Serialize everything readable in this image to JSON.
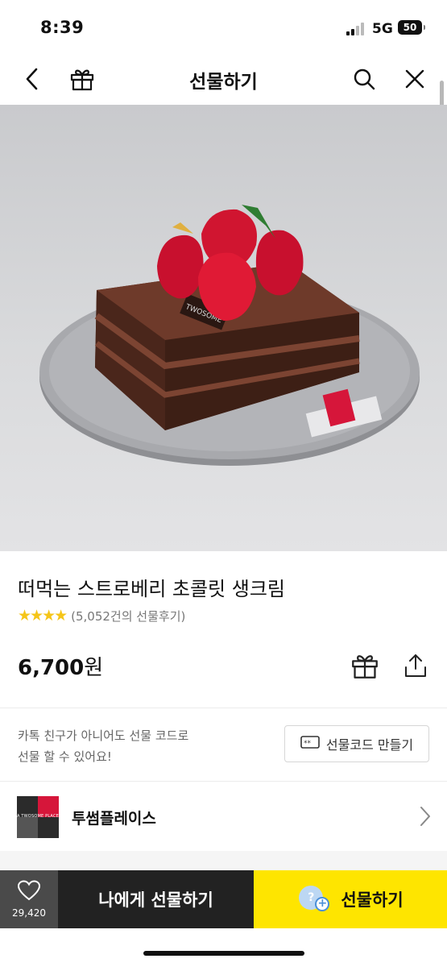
{
  "status_bar": {
    "time": "8:39",
    "network": "5G",
    "battery": "50"
  },
  "header": {
    "title": "선물하기"
  },
  "hero": {
    "topper_text": "TWOSOME"
  },
  "product": {
    "name": "떠먹는 스트로베리 초콜릿 생크림",
    "stars": "★★★★",
    "review_count": "(5,052건의 선물후기)",
    "price_number": "6,700",
    "price_unit": "원"
  },
  "gift_code": {
    "note_line1": "카톡 친구가 아니어도 선물 코드로",
    "note_line2": "선물 할 수 있어요!",
    "button_label": "선물코드 만들기"
  },
  "brand": {
    "name": "투썸플레이스",
    "logo_text": "A TWOSOME PLACE"
  },
  "bottom_bar": {
    "wish_count": "29,420",
    "self_gift_label": "나에게 선물하기",
    "gift_label": "선물하기",
    "gift_icon_char": "?"
  },
  "colors": {
    "accent_yellow": "#fee500",
    "dark_button": "#222222",
    "star": "#f5c518",
    "brand_red": "#d6163a"
  }
}
